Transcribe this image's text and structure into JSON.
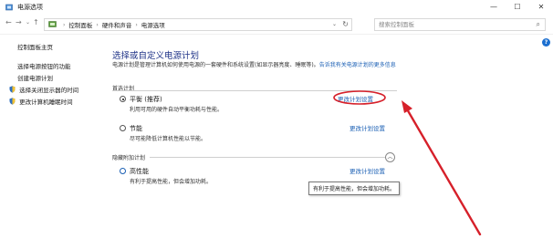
{
  "window": {
    "title": "电源选项",
    "controls": {
      "minimize": "—",
      "maximize": "☐",
      "close": "✕"
    }
  },
  "address_bar": {
    "breadcrumbs": [
      "控制面板",
      "硬件和声音",
      "电源选项"
    ],
    "separator": "›",
    "search_placeholder": "搜索控制面板"
  },
  "sidebar": {
    "items": [
      {
        "label": "控制面板主页",
        "shield": false
      },
      {
        "label": "选择电源按钮的功能",
        "shield": false
      },
      {
        "label": "创建电源计划",
        "shield": false
      },
      {
        "label": "选择关闭显示器的时间",
        "shield": true
      },
      {
        "label": "更改计算机睡眠时间",
        "shield": true
      }
    ]
  },
  "main": {
    "heading": "选择或自定义电源计划",
    "intro_text": "电源计划是管理计算机如何使用电源的一套硬件和系统设置(如显示器亮度、睡眠等)。",
    "intro_link": "告诉我有关电源计划的更多信息",
    "preferred_section": "首选计划",
    "plans": [
      {
        "name": "平衡 (推荐)",
        "desc": "利用可用的硬件自动平衡功耗与性能。",
        "link": "更改计划设置",
        "selected": true
      },
      {
        "name": "节能",
        "desc": "尽可能降低计算机性能以节能。",
        "link": "更改计划设置",
        "selected": false
      }
    ],
    "hidden_section": "隐藏附加计划",
    "hidden_plans": [
      {
        "name": "高性能",
        "desc": "有利于提高性能，但会增加功耗。",
        "link": "更改计划设置",
        "selected": false
      }
    ],
    "tooltip": "有利于提高性能，但会增加功耗。"
  },
  "annotation": {
    "color": "#d6202a",
    "target": "更改计划设置"
  }
}
